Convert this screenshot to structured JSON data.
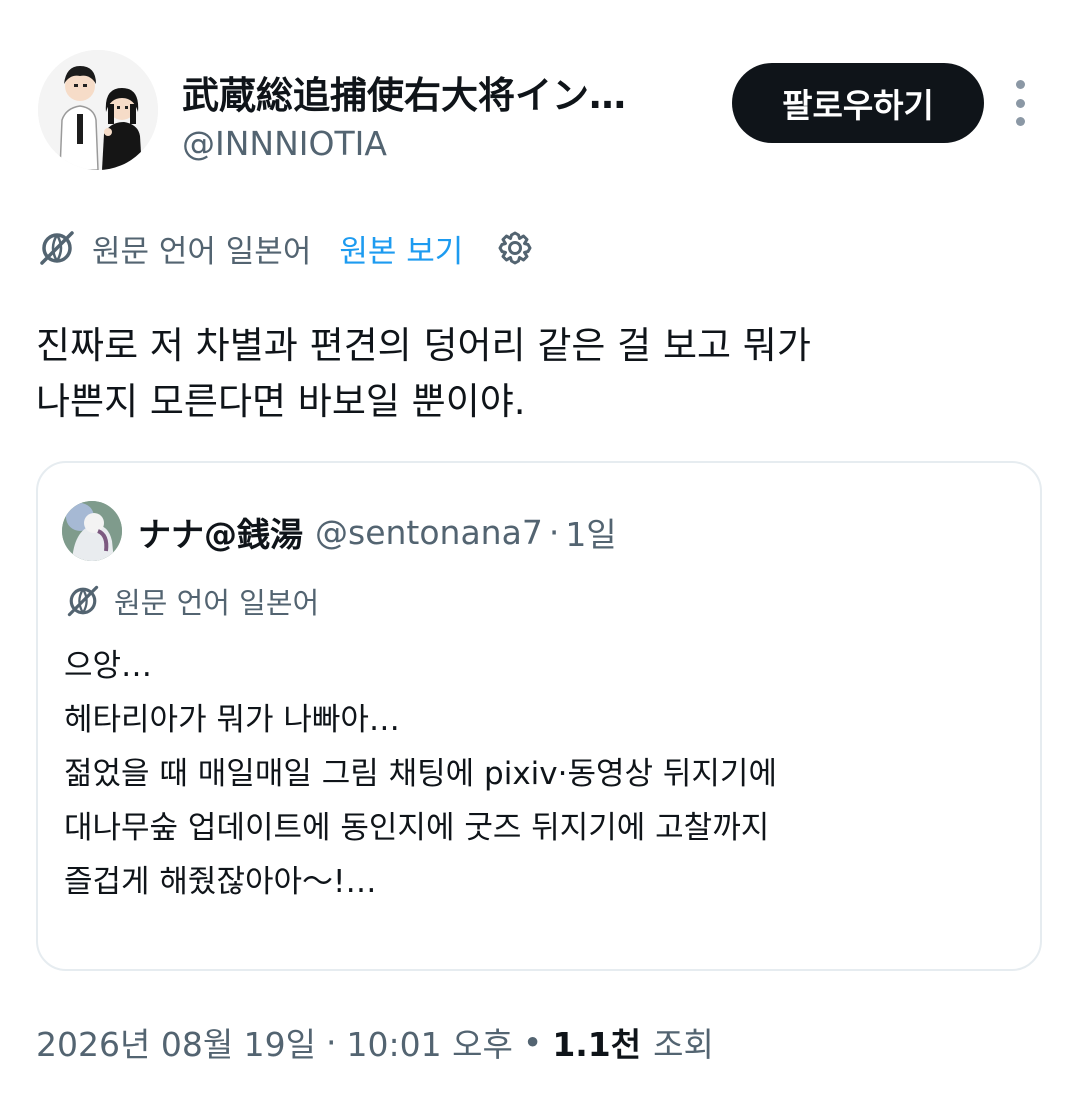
{
  "author": {
    "display_name": "武蔵総追捕使右大将イン…",
    "handle": "@INNNIOTIA",
    "avatar_icon": "anime-couple-avatar-icon"
  },
  "follow_label": "팔로우하기",
  "more_icon": "more-vertical-icon",
  "translation": {
    "icon": "globe-translate-icon",
    "source_label": "원문 언어 일본어",
    "view_original_label": "원본 보기",
    "settings_icon": "gear-icon"
  },
  "tweet_text_lines": [
    "진짜로 저 차별과 편견의 덩어리 같은 걸 보고 뭐가",
    "나쁜지 모른다면 바보일 뿐이야."
  ],
  "quote": {
    "display_name": "ナナ@銭湯",
    "handle": "@sentonana7",
    "separator": "·",
    "time": "1일",
    "translation_label": "원문 언어 일본어",
    "text_lines": [
      "으앙…",
      "헤타리아가 뭐가 나빠아…",
      "젊었을 때 매일매일 그림 채팅에 pixiv·동영상 뒤지기에",
      "대나무숲 업데이트에 동인지에 굿즈 뒤지기에 고찰까지",
      "즐겁게 해줬잖아아～!…"
    ]
  },
  "meta": {
    "date": "2026년 08월 19일",
    "separator": "·",
    "time": "10:01 오후",
    "bullet": "•",
    "views_count": "1.1천",
    "views_label": "조회"
  },
  "colors": {
    "text": "#0f1419",
    "secondary": "#536471",
    "link": "#1d9bf0",
    "button_bg": "#0f1419",
    "border": "#e6ecf0"
  }
}
